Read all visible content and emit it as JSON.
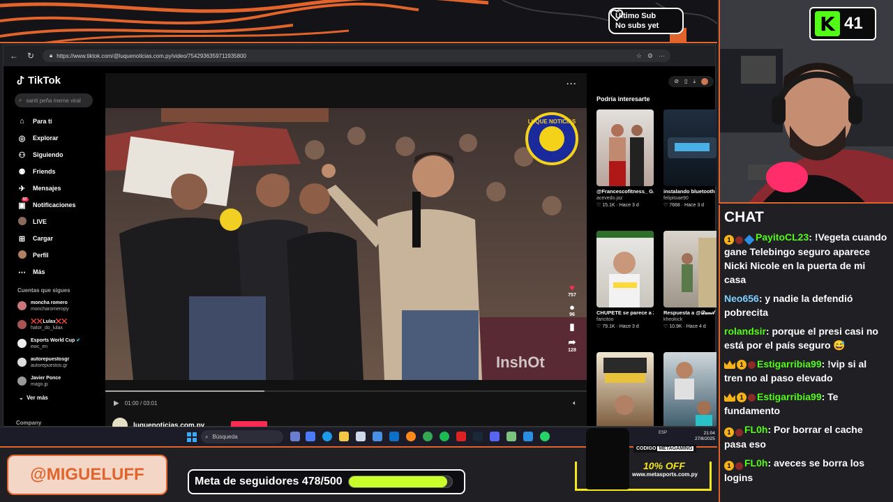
{
  "overlay": {
    "last_sub_title": "Último Sub",
    "last_sub_value": "No subs yet",
    "handle": "@MIGUELUFF",
    "goal_label": "Meta de seguidores 478/500",
    "goal_progress": 0.956,
    "kick_viewers": "41",
    "promo_code_label": "CODIGO",
    "promo_code": "METAGAMING",
    "promo_discount": "10% OFF",
    "promo_site": "www.metasports.com.py",
    "colors": {
      "accent": "#e0642c",
      "kick": "#53fc18",
      "goal": "#c9ff2a",
      "promo": "#f5e81a"
    }
  },
  "browser": {
    "url": "https://www.tiktok.com/@luquenoticias.com.py/video/7542936359711935800"
  },
  "tiktok": {
    "logo": "TikTok",
    "search_placeholder": "santi peña meme viral",
    "nav": [
      {
        "label": "Para ti",
        "icon": "home-icon"
      },
      {
        "label": "Explorar",
        "icon": "compass-icon"
      },
      {
        "label": "Siguiendo",
        "icon": "following-icon"
      },
      {
        "label": "Friends",
        "icon": "friends-icon"
      },
      {
        "label": "Mensajes",
        "icon": "message-icon"
      },
      {
        "label": "Notificaciones",
        "icon": "bell-icon",
        "badge": "57"
      },
      {
        "label": "LIVE",
        "icon": "live-icon"
      },
      {
        "label": "Cargar",
        "icon": "upload-icon"
      },
      {
        "label": "Perfil",
        "icon": "profile-icon"
      },
      {
        "label": "Más",
        "icon": "more-icon"
      }
    ],
    "following_title": "Cuentas que sigues",
    "following": [
      {
        "name": "moncha romero",
        "handle": "moncharomeropy"
      },
      {
        "name": "❌❌Lulax❌❌",
        "handle": "hator_do_lulax"
      },
      {
        "name": "Esports World Cup",
        "handle": "ewc_en"
      },
      {
        "name": "autorepuestosgr",
        "handle": "autorepuestos.gr"
      },
      {
        "name": "Javier Ponce",
        "handle": "mago.jp"
      }
    ],
    "see_more": "Ver más",
    "company": "Company",
    "video": {
      "time": "01:00 / 03:01",
      "progress": 0.33,
      "likes": "757",
      "comments": "96",
      "shares": "128",
      "author": "luquenoticias.com.py",
      "watermark": "LUQUE NOTICIAS"
    },
    "suggestions_title": "Podría interesarte",
    "suggestions": [
      {
        "title": "@Francescofitness_ GANANDO BRO",
        "author": "acevedo.jaz",
        "stats": "15.1K · Hace 3 d"
      },
      {
        "title": "instalando bluetooth para la pioneer...",
        "author": "felipitoae90",
        "stats": "7668 · Hace 3 d"
      },
      {
        "title": "CHUPETE se parece a ZOHAN? -",
        "author": "faricitoo",
        "stats": "79.1K · Hace 3 d"
      },
      {
        "title": "Respuesta a @𝒟𝒶𝓃𝒾𝓁",
        "author": "kheokick",
        "stats": "10.9K · Hace 4 d"
      },
      {
        "title": "",
        "author": "",
        "stats": ""
      },
      {
        "title": "",
        "author": "",
        "stats": ""
      }
    ]
  },
  "taskbar": {
    "search": "Búsqueda",
    "lang": "ESP",
    "time": "21:04",
    "date": "27/8/2025"
  },
  "chat": {
    "title": "CHAT",
    "messages": [
      {
        "user": "PayitoCL23",
        "text": "!Vegeta cuando gane Telebingo seguro aparece Nicki Nicole en la puerta de mi casa",
        "badges": [
          "one",
          "red",
          "gem"
        ],
        "color": "green"
      },
      {
        "user": "Neo656",
        "text": "y nadie la defendió pobrecita",
        "badges": [],
        "color": "blue"
      },
      {
        "user": "rolandsir",
        "text": "porque el presi casi no está por el país seguro 😅",
        "badges": [],
        "color": "green"
      },
      {
        "user": "Estigarribia99",
        "text": "!vip si al tren no al paso elevado",
        "badges": [
          "crown",
          "one",
          "red"
        ],
        "color": "green"
      },
      {
        "user": "Estigarribia99",
        "text": "Te fundamento",
        "badges": [
          "crown",
          "one",
          "red"
        ],
        "color": "green"
      },
      {
        "user": "FL0h",
        "text": "Por borrar el cache pasa eso",
        "badges": [
          "one",
          "red"
        ],
        "color": "green"
      },
      {
        "user": "FL0h",
        "text": "aveces se borra los logins",
        "badges": [
          "one",
          "red"
        ],
        "color": "green"
      }
    ]
  }
}
